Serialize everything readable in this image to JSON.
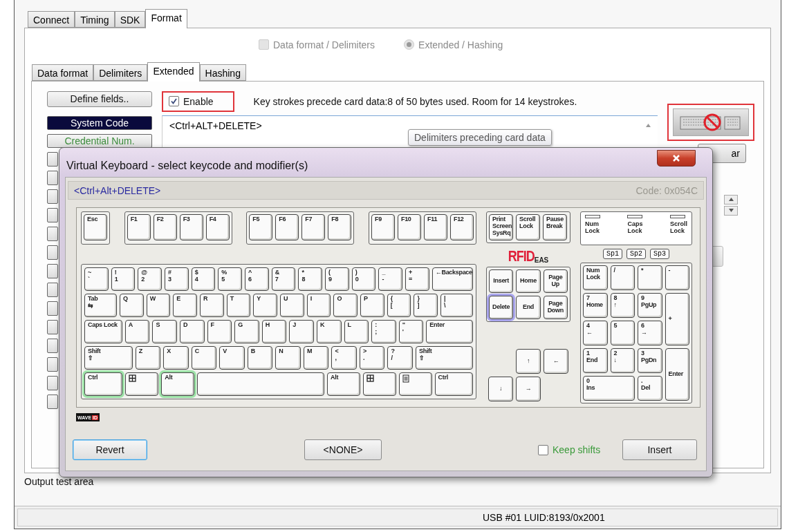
{
  "tabs": [
    {
      "label": "Connect",
      "selected": false
    },
    {
      "label": "Timing",
      "selected": false
    },
    {
      "label": "SDK",
      "selected": false
    },
    {
      "label": "Format",
      "selected": true
    }
  ],
  "mode_options": [
    {
      "label": "Data format / Delimiters",
      "kind": "checkbox",
      "selected": false,
      "disabled": true
    },
    {
      "label": "Extended / Hashing",
      "kind": "radio",
      "selected": true,
      "disabled": true
    }
  ],
  "subtabs": [
    {
      "label": "Data format",
      "selected": false
    },
    {
      "label": "Delimiters",
      "selected": false
    },
    {
      "label": "Extended",
      "selected": true
    },
    {
      "label": "Hashing",
      "selected": false
    }
  ],
  "define_button": "Define fields..",
  "enable": {
    "label": "Enable",
    "checked": true
  },
  "info": "Key strokes precede card data:8 of 50 bytes used. Room for 14 keystrokes.",
  "sequence_value": "<Ctrl+ALT+DELETE>",
  "tooltip": "Delimiters preceding card data",
  "fields": [
    {
      "label": "System Code",
      "selected": true
    },
    {
      "label": "Credential Num.",
      "selected": false
    }
  ],
  "clear_button": "ar",
  "output_label": "Output test area",
  "status": "USB #01 LUID:8193/0x2001",
  "dialog": {
    "title": "Virtual Keyboard - select keycode and modifier(s)",
    "value": "<Ctrl+Alt+DELETE>",
    "code": "Code: 0x054C",
    "function_groups": [
      {
        "keys": [
          {
            "lines": [
              "Esc"
            ],
            "kind": "char",
            "selected": false
          }
        ]
      },
      {
        "keys": [
          {
            "lines": [
              "F1"
            ],
            "kind": "char",
            "selected": false
          },
          {
            "lines": [
              "F2"
            ],
            "kind": "char",
            "selected": false
          },
          {
            "lines": [
              "F3"
            ],
            "kind": "char",
            "selected": false
          },
          {
            "lines": [
              "F4"
            ],
            "kind": "char",
            "selected": false
          }
        ]
      },
      {
        "keys": [
          {
            "lines": [
              "F5"
            ],
            "kind": "char",
            "selected": false
          },
          {
            "lines": [
              "F6"
            ],
            "kind": "char",
            "selected": false
          },
          {
            "lines": [
              "F7"
            ],
            "kind": "char",
            "selected": false
          },
          {
            "lines": [
              "F8"
            ],
            "kind": "char",
            "selected": false
          }
        ]
      },
      {
        "keys": [
          {
            "lines": [
              "F9"
            ],
            "kind": "char",
            "selected": false
          },
          {
            "lines": [
              "F10"
            ],
            "kind": "char",
            "selected": false
          },
          {
            "lines": [
              "F11"
            ],
            "kind": "char",
            "selected": false
          },
          {
            "lines": [
              "F12"
            ],
            "kind": "char",
            "selected": false
          }
        ]
      }
    ],
    "main_rows": [
      {
        "keys": [
          {
            "lines": [
              "~",
              "`"
            ],
            "kind": "char",
            "selected": false
          },
          {
            "lines": [
              "!",
              "1"
            ],
            "kind": "char",
            "selected": false
          },
          {
            "lines": [
              "@",
              "2"
            ],
            "kind": "char",
            "selected": false
          },
          {
            "lines": [
              "#",
              "3"
            ],
            "kind": "char",
            "selected": false
          },
          {
            "lines": [
              "$",
              "4"
            ],
            "kind": "char",
            "selected": false
          },
          {
            "lines": [
              "%",
              "5"
            ],
            "kind": "char",
            "selected": false
          },
          {
            "lines": [
              "^",
              "6"
            ],
            "kind": "char",
            "selected": false
          },
          {
            "lines": [
              "&",
              "7"
            ],
            "kind": "char",
            "selected": false
          },
          {
            "lines": [
              "*",
              "8"
            ],
            "kind": "char",
            "selected": false
          },
          {
            "lines": [
              "(",
              "9"
            ],
            "kind": "char",
            "selected": false
          },
          {
            "lines": [
              ")",
              "0"
            ],
            "kind": "char",
            "selected": false
          },
          {
            "lines": [
              "_",
              "-"
            ],
            "kind": "char",
            "selected": false
          },
          {
            "lines": [
              "+",
              "="
            ],
            "kind": "char",
            "selected": false
          },
          {
            "lines": [
              "←Backspace"
            ],
            "kind": "backspace",
            "selected": false
          }
        ]
      },
      {
        "keys": [
          {
            "lines": [
              "Tab",
              "⇆"
            ],
            "kind": "tab",
            "selected": false
          },
          {
            "lines": [
              "Q"
            ],
            "kind": "char",
            "selected": false
          },
          {
            "lines": [
              "W"
            ],
            "kind": "char",
            "selected": false
          },
          {
            "lines": [
              "E"
            ],
            "kind": "char",
            "selected": false
          },
          {
            "lines": [
              "R"
            ],
            "kind": "char",
            "selected": false
          },
          {
            "lines": [
              "T"
            ],
            "kind": "char",
            "selected": false
          },
          {
            "lines": [
              "Y"
            ],
            "kind": "char",
            "selected": false
          },
          {
            "lines": [
              "U"
            ],
            "kind": "char",
            "selected": false
          },
          {
            "lines": [
              "I"
            ],
            "kind": "char",
            "selected": false
          },
          {
            "lines": [
              "O"
            ],
            "kind": "char",
            "selected": false
          },
          {
            "lines": [
              "P"
            ],
            "kind": "char",
            "selected": false
          },
          {
            "lines": [
              "{",
              "["
            ],
            "kind": "char",
            "selected": false
          },
          {
            "lines": [
              "}",
              "]"
            ],
            "kind": "char",
            "selected": false
          },
          {
            "lines": [
              "|",
              "\\"
            ],
            "kind": "backslash",
            "selected": false
          }
        ]
      },
      {
        "keys": [
          {
            "lines": [
              "Caps Lock"
            ],
            "kind": "caps",
            "selected": false
          },
          {
            "lines": [
              "A"
            ],
            "kind": "char",
            "selected": false
          },
          {
            "lines": [
              "S"
            ],
            "kind": "char",
            "selected": false
          },
          {
            "lines": [
              "D"
            ],
            "kind": "char",
            "selected": false
          },
          {
            "lines": [
              "F"
            ],
            "kind": "char",
            "selected": false
          },
          {
            "lines": [
              "G"
            ],
            "kind": "char",
            "selected": false
          },
          {
            "lines": [
              "H"
            ],
            "kind": "char",
            "selected": false
          },
          {
            "lines": [
              "J"
            ],
            "kind": "char",
            "selected": false
          },
          {
            "lines": [
              "K"
            ],
            "kind": "char",
            "selected": false
          },
          {
            "lines": [
              "L"
            ],
            "kind": "char",
            "selected": false
          },
          {
            "lines": [
              ":",
              ";"
            ],
            "kind": "char",
            "selected": false
          },
          {
            "lines": [
              "\"",
              "'"
            ],
            "kind": "char",
            "selected": false
          },
          {
            "lines": [
              "Enter"
            ],
            "kind": "enter",
            "selected": false
          }
        ]
      },
      {
        "keys": [
          {
            "lines": [
              "Shift",
              "⇧"
            ],
            "kind": "shift",
            "selected": false
          },
          {
            "lines": [
              "Z"
            ],
            "kind": "char",
            "selected": false
          },
          {
            "lines": [
              "X"
            ],
            "kind": "char",
            "selected": false
          },
          {
            "lines": [
              "C"
            ],
            "kind": "char",
            "selected": false
          },
          {
            "lines": [
              "V"
            ],
            "kind": "char",
            "selected": false
          },
          {
            "lines": [
              "B"
            ],
            "kind": "char",
            "selected": false
          },
          {
            "lines": [
              "N"
            ],
            "kind": "char",
            "selected": false
          },
          {
            "lines": [
              "M"
            ],
            "kind": "char",
            "selected": false
          },
          {
            "lines": [
              "<",
              ","
            ],
            "kind": "char",
            "selected": false
          },
          {
            "lines": [
              ">",
              "."
            ],
            "kind": "char",
            "selected": false
          },
          {
            "lines": [
              "?",
              "/"
            ],
            "kind": "char",
            "selected": false
          },
          {
            "lines": [
              "Shift",
              "⇧"
            ],
            "kind": "rshift",
            "selected": false
          }
        ]
      },
      {
        "keys": [
          {
            "lines": [
              "Ctrl"
            ],
            "kind": "ctrl",
            "selected": true
          },
          {
            "kind": "win",
            "selected": false
          },
          {
            "lines": [
              "Alt"
            ],
            "kind": "alt",
            "selected": true
          },
          {
            "kind": "space",
            "selected": false
          },
          {
            "lines": [
              "Alt"
            ],
            "kind": "alt",
            "selected": false
          },
          {
            "kind": "win",
            "selected": false
          },
          {
            "kind": "menu",
            "selected": false
          },
          {
            "lines": [
              "Ctrl"
            ],
            "kind": "ctrl",
            "selected": false
          }
        ]
      }
    ],
    "nav_top": [
      {
        "lines": [
          "Print",
          "Screen",
          "SysRq"
        ],
        "kind": "char",
        "selected": false
      },
      {
        "lines": [
          "Scroll",
          "Lock"
        ],
        "kind": "char",
        "selected": false
      },
      {
        "lines": [
          "Pause",
          "Break"
        ],
        "kind": "char",
        "selected": false
      }
    ],
    "brand": {
      "name": "RFID",
      "suffix": "EAS"
    },
    "nav_keys": [
      {
        "lines": [
          "Insert"
        ],
        "kind": "char",
        "selected": false
      },
      {
        "lines": [
          "Home"
        ],
        "kind": "char",
        "selected": false
      },
      {
        "lines": [
          "Page",
          "Up"
        ],
        "kind": "char",
        "selected": false
      },
      {
        "lines": [
          "Delete"
        ],
        "kind": "char",
        "selected": true
      },
      {
        "lines": [
          "End"
        ],
        "kind": "char",
        "selected": false
      },
      {
        "lines": [
          "Page",
          "Down"
        ],
        "kind": "char",
        "selected": false
      }
    ],
    "arrow_keys": [
      {
        "lines": [
          "↑"
        ],
        "kind": "char",
        "selected": false
      },
      {
        "lines": [
          "←"
        ],
        "kind": "char",
        "selected": false
      },
      {
        "lines": [
          "↓"
        ],
        "kind": "char",
        "selected": false
      },
      {
        "lines": [
          "→"
        ],
        "kind": "char",
        "selected": false
      }
    ],
    "indicators": [
      {
        "lines": [
          "Num",
          "Lock"
        ],
        "on": false
      },
      {
        "lines": [
          "Caps",
          "Lock"
        ],
        "on": false
      },
      {
        "lines": [
          "Scroll",
          "Lock"
        ],
        "on": false
      }
    ],
    "special_buttons": [
      "Sp1",
      "Sp2",
      "Sp3"
    ],
    "numpad": [
      {
        "lines": [
          "Num",
          "Lock"
        ],
        "kind": "char",
        "selected": false
      },
      {
        "lines": [
          "/"
        ],
        "kind": "char",
        "selected": false
      },
      {
        "lines": [
          "*"
        ],
        "kind": "char",
        "selected": false
      },
      {
        "lines": [
          "-"
        ],
        "kind": "char",
        "selected": false
      },
      {
        "lines": [
          "7",
          "Home"
        ],
        "kind": "char",
        "selected": false
      },
      {
        "lines": [
          "8",
          "↑"
        ],
        "kind": "char",
        "selected": false
      },
      {
        "lines": [
          "9",
          "PgUp"
        ],
        "kind": "char",
        "selected": false
      },
      {
        "lines": [
          "+"
        ],
        "kind": "tall",
        "selected": false
      },
      {
        "lines": [
          "4",
          "←"
        ],
        "kind": "char",
        "selected": false
      },
      {
        "lines": [
          "5"
        ],
        "kind": "char",
        "selected": false
      },
      {
        "lines": [
          "6",
          "→"
        ],
        "kind": "char",
        "selected": false
      },
      {
        "lines": [
          "1",
          "End"
        ],
        "kind": "char",
        "selected": false
      },
      {
        "lines": [
          "2",
          "↓"
        ],
        "kind": "char",
        "selected": false
      },
      {
        "lines": [
          "3",
          "PgDn"
        ],
        "kind": "char",
        "selected": false
      },
      {
        "lines": [
          "Enter"
        ],
        "kind": "tall",
        "selected": false
      },
      {
        "lines": [
          "0",
          "Ins"
        ],
        "kind": "wide",
        "selected": false
      },
      {
        "lines": [
          ".",
          "Del"
        ],
        "kind": "char",
        "selected": false
      }
    ],
    "wave_logo": {
      "left": "WAVE",
      "right": "ID"
    },
    "footer": [
      {
        "kind": "button",
        "label": "Revert",
        "focused": true
      },
      {
        "kind": "button",
        "label": "<NONE>",
        "focused": false
      },
      {
        "kind": "checkbox",
        "label": "Keep shifts",
        "checked": false
      },
      {
        "kind": "button",
        "label": "Insert",
        "focused": false
      }
    ]
  }
}
